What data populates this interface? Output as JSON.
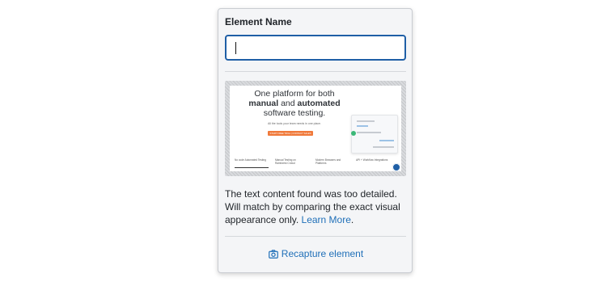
{
  "panel": {
    "field_label": "Element Name",
    "input_value": "",
    "input_placeholder": "",
    "thumbnail": {
      "headline_1": "One platform for both",
      "headline_2a": "manual",
      "headline_2b": " and ",
      "headline_2c": "automated",
      "headline_3": "software testing.",
      "subline": "All the tools your team needs in one place.",
      "cta": "START FREE TRIAL | CONTACT SALES",
      "tabs": [
        "No code Automated Testing",
        "Manual Testing on Rainforest Crowd",
        "Modern Browsers and Platforms",
        "API + Workflow Integrations"
      ]
    },
    "info_text": "The text content found was too detailed. Will match by comparing the exact visual appearance only.",
    "learn_more_label": "Learn More",
    "info_suffix": ".",
    "recapture_label": "Recapture element",
    "icons": {
      "recapture": "camera-icon"
    },
    "colors": {
      "accent": "#1f6fb8",
      "input_border": "#1f5fa6",
      "cta": "#f0793a"
    }
  }
}
